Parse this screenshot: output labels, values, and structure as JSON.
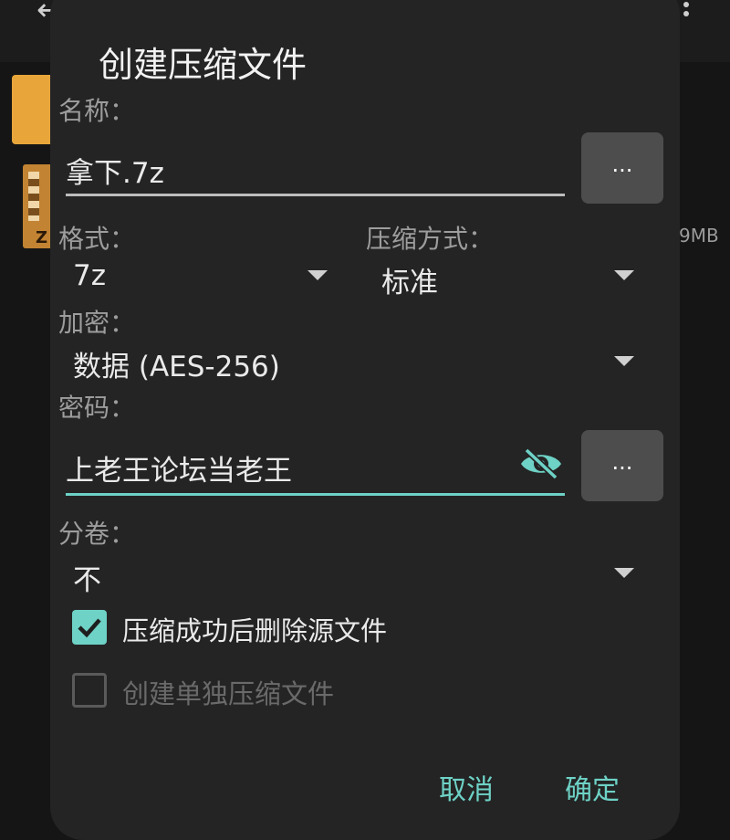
{
  "background": {
    "size_text": "9MB"
  },
  "dialog": {
    "title": "创建压缩文件",
    "name_label": "名称：",
    "name_value": "拿下.7z",
    "browse_label": "...",
    "format_label": "格式：",
    "format_value": "7z",
    "compression_label": "压缩方式：",
    "compression_value": "标准",
    "encryption_label": "加密：",
    "encryption_value": "数据 (AES-256)",
    "password_label": "密码：",
    "password_value": "上老王论坛当老王",
    "password_more_label": "...",
    "split_label": "分卷：",
    "split_value": "不",
    "delete_source": {
      "label": "压缩成功后删除源文件",
      "checked": true
    },
    "separate_archives": {
      "label": "创建单独压缩文件",
      "checked": false,
      "enabled": false
    },
    "cancel_label": "取消",
    "confirm_label": "确定"
  },
  "colors": {
    "accent": "#6ed2c6",
    "dialog_bg": "#242424"
  }
}
